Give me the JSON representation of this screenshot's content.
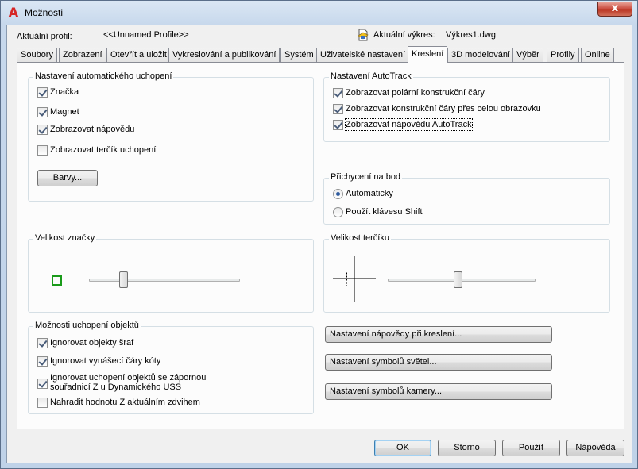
{
  "window": {
    "title": "Možnosti",
    "app_icon": "autocad-icon",
    "close_label": "x"
  },
  "header": {
    "profile_label": "Aktuální profil:",
    "profile_value": "<<Unnamed Profile>>",
    "drawing_label": "Aktuální výkres:",
    "drawing_value": "Výkres1.dwg",
    "drawing_icon": "drawing-file-icon"
  },
  "tabs": [
    {
      "label": "Soubory"
    },
    {
      "label": "Zobrazení"
    },
    {
      "label": "Otevřít a uložit"
    },
    {
      "label": "Vykreslování a publikování"
    },
    {
      "label": "Systém"
    },
    {
      "label": "Uživatelské nastavení"
    },
    {
      "label": "Kreslení"
    },
    {
      "label": "3D modelování"
    },
    {
      "label": "Výběr"
    },
    {
      "label": "Profily"
    },
    {
      "label": "Online"
    }
  ],
  "active_tab": "Kreslení",
  "autosnap": {
    "title": "Nastavení automatického uchopení",
    "items": [
      {
        "label": "Značka",
        "checked": true
      },
      {
        "label": "Magnet",
        "checked": true
      },
      {
        "label": "Zobrazovat nápovědu",
        "checked": true
      },
      {
        "label": "Zobrazovat terčík uchopení",
        "checked": false
      }
    ],
    "colors_button": "Barvy..."
  },
  "marker_size": {
    "title": "Velikost značky",
    "preview_color": "#1a9b1a"
  },
  "osnap_options": {
    "title": "Možnosti uchopení objektů",
    "items": [
      {
        "label": "Ignorovat objekty šraf",
        "checked": true
      },
      {
        "label": "Ignorovat vynášecí čáry kóty",
        "checked": true
      },
      {
        "label": "Ignorovat uchopení objektů se zápornou",
        "label2": "souřadnicí Z u Dynamického USS",
        "checked": true
      },
      {
        "label": "Nahradit hodnotu Z aktuálním zdvihem",
        "checked": false
      }
    ]
  },
  "autotrack": {
    "title": "Nastavení AutoTrack",
    "items": [
      {
        "label": "Zobrazovat polární konstrukční čáry",
        "checked": true
      },
      {
        "label": "Zobrazovat konstrukční čáry přes celou obrazovku",
        "checked": true
      },
      {
        "label": "Zobrazovat nápovědu AutoTrack",
        "checked": true
      }
    ]
  },
  "alignment": {
    "title": "Přichycení na bod",
    "options": [
      {
        "label": "Automaticky",
        "selected": true
      },
      {
        "label": "Použít klávesu Shift",
        "selected": false
      }
    ]
  },
  "aperture_size": {
    "title": "Velikost terčíku"
  },
  "side_buttons": {
    "drafting_tooltip": "Nastavení nápovědy při kreslení...",
    "lights_glyph": "Nastavení symbolů světel...",
    "cameras_glyph": "Nastavení symbolů kamery..."
  },
  "footer": {
    "ok": "OK",
    "cancel": "Storno",
    "apply": "Použít",
    "help": "Nápověda"
  }
}
